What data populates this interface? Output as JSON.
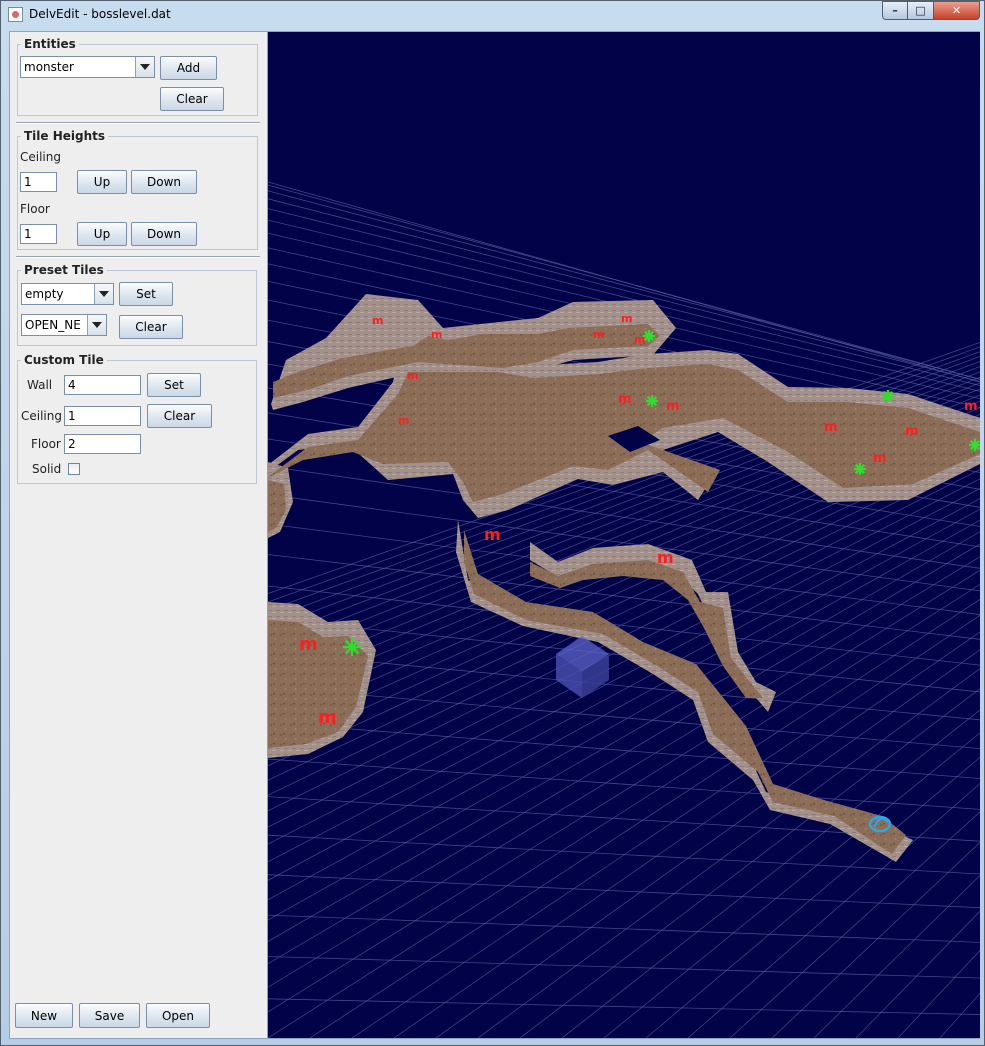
{
  "window": {
    "title": "DelvEdit - bosslevel.dat",
    "minimize": "–",
    "maximize": "□",
    "close": "✕"
  },
  "entities": {
    "legend": "Entities",
    "selected": "monster",
    "add": "Add",
    "clear": "Clear"
  },
  "tile_heights": {
    "legend": "Tile Heights",
    "ceiling_label": "Ceiling",
    "ceiling_value": "1",
    "floor_label": "Floor",
    "floor_value": "1",
    "up": "Up",
    "down": "Down"
  },
  "preset_tiles": {
    "legend": "Preset Tiles",
    "tile_selected": "empty",
    "dir_selected": "OPEN_NE",
    "set": "Set",
    "clear": "Clear"
  },
  "custom_tile": {
    "legend": "Custom Tile",
    "wall_label": "Wall",
    "wall_value": "4",
    "ceiling_label": "Ceiling",
    "ceiling_value": "1",
    "floor_label": "Floor",
    "floor_value": "2",
    "solid_label": "Solid",
    "set": "Set",
    "clear": "Clear"
  },
  "file": {
    "new": "New",
    "save": "Save",
    "open": "Open"
  },
  "viewport": {
    "monster_marker": "m",
    "colors": {
      "background": "#010248",
      "grid": "#5d63a8",
      "floor": "#8c6e58",
      "wall": "#a3908a",
      "monster": "#ff1e1e",
      "item": "#2ee02e",
      "exit": "#2aa8e8",
      "cursor": "#6a70d8"
    }
  }
}
